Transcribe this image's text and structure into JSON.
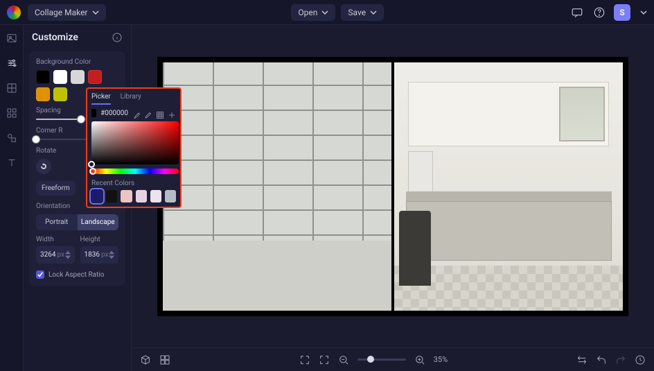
{
  "topbar": {
    "app_name": "Collage Maker",
    "open_label": "Open",
    "save_label": "Save",
    "avatar_initial": "S"
  },
  "panel": {
    "title": "Customize",
    "bg_color_label": "Background Color",
    "bg_swatches": [
      "#000000",
      "#ffffff",
      "#d7d7d7",
      "#c41d1d",
      "#e09000",
      "#c0c000"
    ],
    "spacing_label": "Spacing",
    "spacing_percent": 55,
    "corner_label": "Corner R",
    "corner_percent": 0,
    "rotate_label": "Rotate",
    "freeform_label": "Freeform",
    "orientation_label": "Orientation",
    "orientation_options": [
      "Portrait",
      "Landscape"
    ],
    "orientation_selected": "Landscape",
    "width_label": "Width",
    "height_label": "Height",
    "width_value": "3264",
    "height_value": "1836",
    "unit": "px",
    "lock_aspect_label": "Lock Aspect Ratio",
    "lock_aspect": true
  },
  "picker": {
    "tabs": [
      "Picker",
      "Library"
    ],
    "active_tab": "Picker",
    "hex": "#000000",
    "recent_label": "Recent Colors",
    "recent": [
      "#1a1b6e",
      "#111111",
      "#ecc4c4",
      "#e7d2e3",
      "#ece3ec",
      "#b4bcc6"
    ],
    "recent_selected": 0
  },
  "toolbar": {
    "zoom_level": "35%"
  }
}
